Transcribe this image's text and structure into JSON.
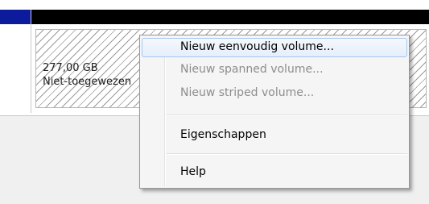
{
  "disk_map": {
    "partition": {
      "size": "277,00 GB",
      "status": "Niet-toegewezen"
    }
  },
  "context_menu": {
    "items": [
      {
        "label": "Nieuw eenvoudig volume...",
        "enabled": true,
        "highlighted": true
      },
      {
        "label": "Nieuw spanned volume...",
        "enabled": false
      },
      {
        "label": "Nieuw striped volume...",
        "enabled": false
      },
      {
        "label": "Eigenschappen",
        "enabled": true
      },
      {
        "label": "Help",
        "enabled": true
      }
    ]
  },
  "colors": {
    "disk_header_blue": "#0b1b9c",
    "partition_header_black": "#000000",
    "menu_highlight_border": "#a8c6ee",
    "disabled_text": "#8d8d8d"
  }
}
